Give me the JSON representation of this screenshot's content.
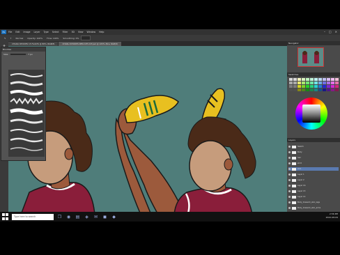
{
  "app": {
    "menu": [
      "File",
      "Edit",
      "Image",
      "Layer",
      "Type",
      "Select",
      "Filter",
      "3D",
      "View",
      "Window",
      "Help"
    ],
    "options": {
      "size": "7",
      "mode": "Normal",
      "opacity": "Opacity: 100%",
      "flow": "Flow: 100%",
      "smoothing": "Smoothing: 0%"
    },
    "tabs": [
      {
        "label": "CHARLI RHODES 15 FLOATS @ 80% (RGB/8)",
        "active": false
      },
      {
        "label": "CHARLI RHODES NEW KITS KIT.psd @ 105% (Bra, RGB/8)",
        "active": true
      }
    ],
    "status": "105.34%"
  },
  "brush_panel": {
    "title": "Brushes",
    "size_label": "Size:",
    "size_value": "7 px",
    "brush_count": 9
  },
  "right_panel": {
    "navigator_title": "Navigator",
    "swatches_title": "Swatches",
    "layers_title": "Layers",
    "layers": [
      {
        "name": "Sketch",
        "selected": false
      },
      {
        "name": "Body",
        "selected": false
      },
      {
        "name": "hair",
        "selected": false
      },
      {
        "name": "shirt",
        "selected": false
      },
      {
        "name": "skin",
        "selected": true
      },
      {
        "name": "Layer 1",
        "selected": false
      },
      {
        "name": "Layer 2",
        "selected": false
      },
      {
        "name": "Layer 16",
        "selected": false
      },
      {
        "name": "Layer 15",
        "selected": false
      },
      {
        "name": "Layer 14",
        "selected": false
      },
      {
        "name": "Body_linework_skin_legs",
        "selected": false
      },
      {
        "name": "Body_linework_skin_arms",
        "selected": false
      },
      {
        "name": "Body_linework_shirt",
        "selected": false
      },
      {
        "name": "Background",
        "selected": false
      }
    ]
  },
  "taskbar": {
    "search_placeholder": "Type here to search",
    "time": "2:56 PM",
    "date": "2022-08-09"
  },
  "colors": {
    "canvas": "#4f7d7a",
    "skin": "#9c5a3c",
    "shirt": "#8a1e3a",
    "hair": "#4a2a18",
    "boot": "#e8c020"
  }
}
